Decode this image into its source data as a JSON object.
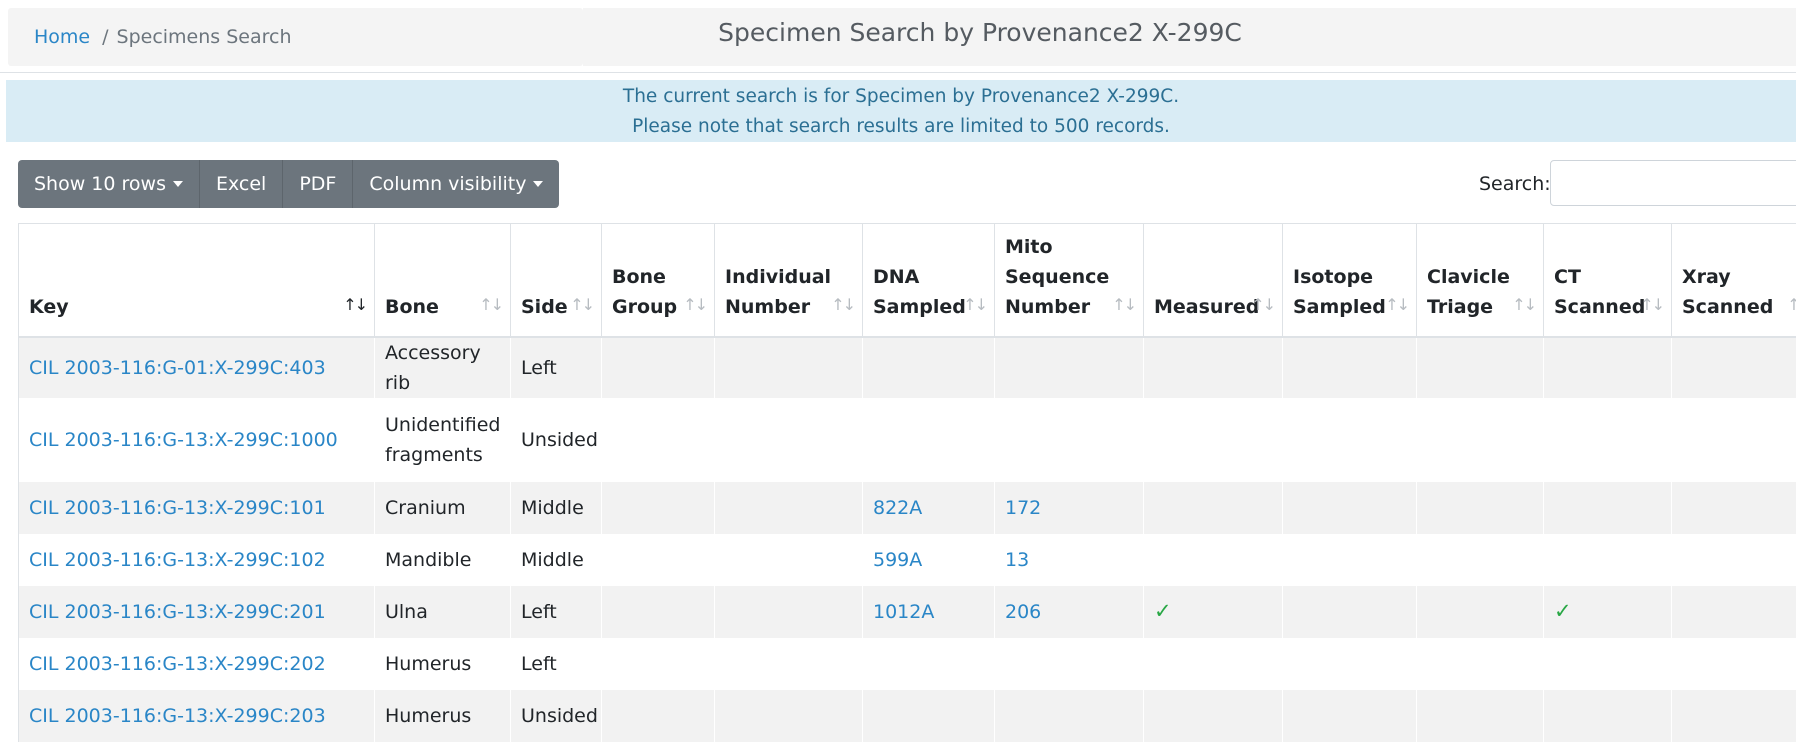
{
  "breadcrumb": {
    "home": "Home",
    "separator": "/",
    "current": "Specimens Search"
  },
  "page_title": "Specimen Search by Provenance2 X-299C",
  "alert": {
    "line1": "The current search is for Specimen by Provenance2 X-299C.",
    "line2": "Please note that search results are limited to 500 records."
  },
  "toolbar": {
    "show_rows": "Show 10 rows",
    "excel": "Excel",
    "pdf": "PDF",
    "column_visibility": "Column visibility"
  },
  "search": {
    "label": "Search:",
    "value": ""
  },
  "columns": [
    [
      "Key"
    ],
    [
      "Bone"
    ],
    [
      "Side"
    ],
    [
      "Bone",
      "Group"
    ],
    [
      "Individual",
      "Number"
    ],
    [
      "DNA",
      "Sampled"
    ],
    [
      "Mito",
      "Sequence",
      "Number"
    ],
    [
      "Measured"
    ],
    [
      "Isotope",
      "Sampled"
    ],
    [
      "Clavicle",
      "Triage"
    ],
    [
      "CT",
      "Scanned"
    ],
    [
      "Xray",
      "Scanned"
    ]
  ],
  "sort_glyph": "↑↓",
  "check_glyph": "✓",
  "rows": [
    {
      "key": "CIL 2003-116:G-01:X-299C:403",
      "bone": [
        "Accessory rib"
      ],
      "side": "Left",
      "bone_group": "",
      "individual_number": "",
      "dna_sampled": "",
      "mito_sequence": "",
      "measured": false,
      "isotope": "",
      "clavicle": "",
      "ct_scanned": false,
      "xray": ""
    },
    {
      "key": "CIL 2003-116:G-13:X-299C:1000",
      "bone": [
        "Unidentified",
        "fragments"
      ],
      "side": "Unsided",
      "bone_group": "",
      "individual_number": "",
      "dna_sampled": "",
      "mito_sequence": "",
      "measured": false,
      "isotope": "",
      "clavicle": "",
      "ct_scanned": false,
      "xray": ""
    },
    {
      "key": "CIL 2003-116:G-13:X-299C:101",
      "bone": [
        "Cranium"
      ],
      "side": "Middle",
      "bone_group": "",
      "individual_number": "",
      "dna_sampled": "822A",
      "mito_sequence": "172",
      "measured": false,
      "isotope": "",
      "clavicle": "",
      "ct_scanned": false,
      "xray": ""
    },
    {
      "key": "CIL 2003-116:G-13:X-299C:102",
      "bone": [
        "Mandible"
      ],
      "side": "Middle",
      "bone_group": "",
      "individual_number": "",
      "dna_sampled": "599A",
      "mito_sequence": "13",
      "measured": false,
      "isotope": "",
      "clavicle": "",
      "ct_scanned": false,
      "xray": ""
    },
    {
      "key": "CIL 2003-116:G-13:X-299C:201",
      "bone": [
        "Ulna"
      ],
      "side": "Left",
      "bone_group": "",
      "individual_number": "",
      "dna_sampled": "1012A",
      "mito_sequence": "206",
      "measured": true,
      "isotope": "",
      "clavicle": "",
      "ct_scanned": true,
      "xray": ""
    },
    {
      "key": "CIL 2003-116:G-13:X-299C:202",
      "bone": [
        "Humerus"
      ],
      "side": "Left",
      "bone_group": "",
      "individual_number": "",
      "dna_sampled": "",
      "mito_sequence": "",
      "measured": false,
      "isotope": "",
      "clavicle": "",
      "ct_scanned": false,
      "xray": ""
    },
    {
      "key": "CIL 2003-116:G-13:X-299C:203",
      "bone": [
        "Humerus"
      ],
      "side": "Unsided",
      "bone_group": "",
      "individual_number": "",
      "dna_sampled": "",
      "mito_sequence": "",
      "measured": false,
      "isotope": "",
      "clavicle": "",
      "ct_scanned": false,
      "xray": ""
    }
  ],
  "colors": {
    "link": "#2a86c7",
    "check": "#28a745",
    "alert_bg": "#d9ecf5",
    "button_bg": "#6c757d"
  }
}
